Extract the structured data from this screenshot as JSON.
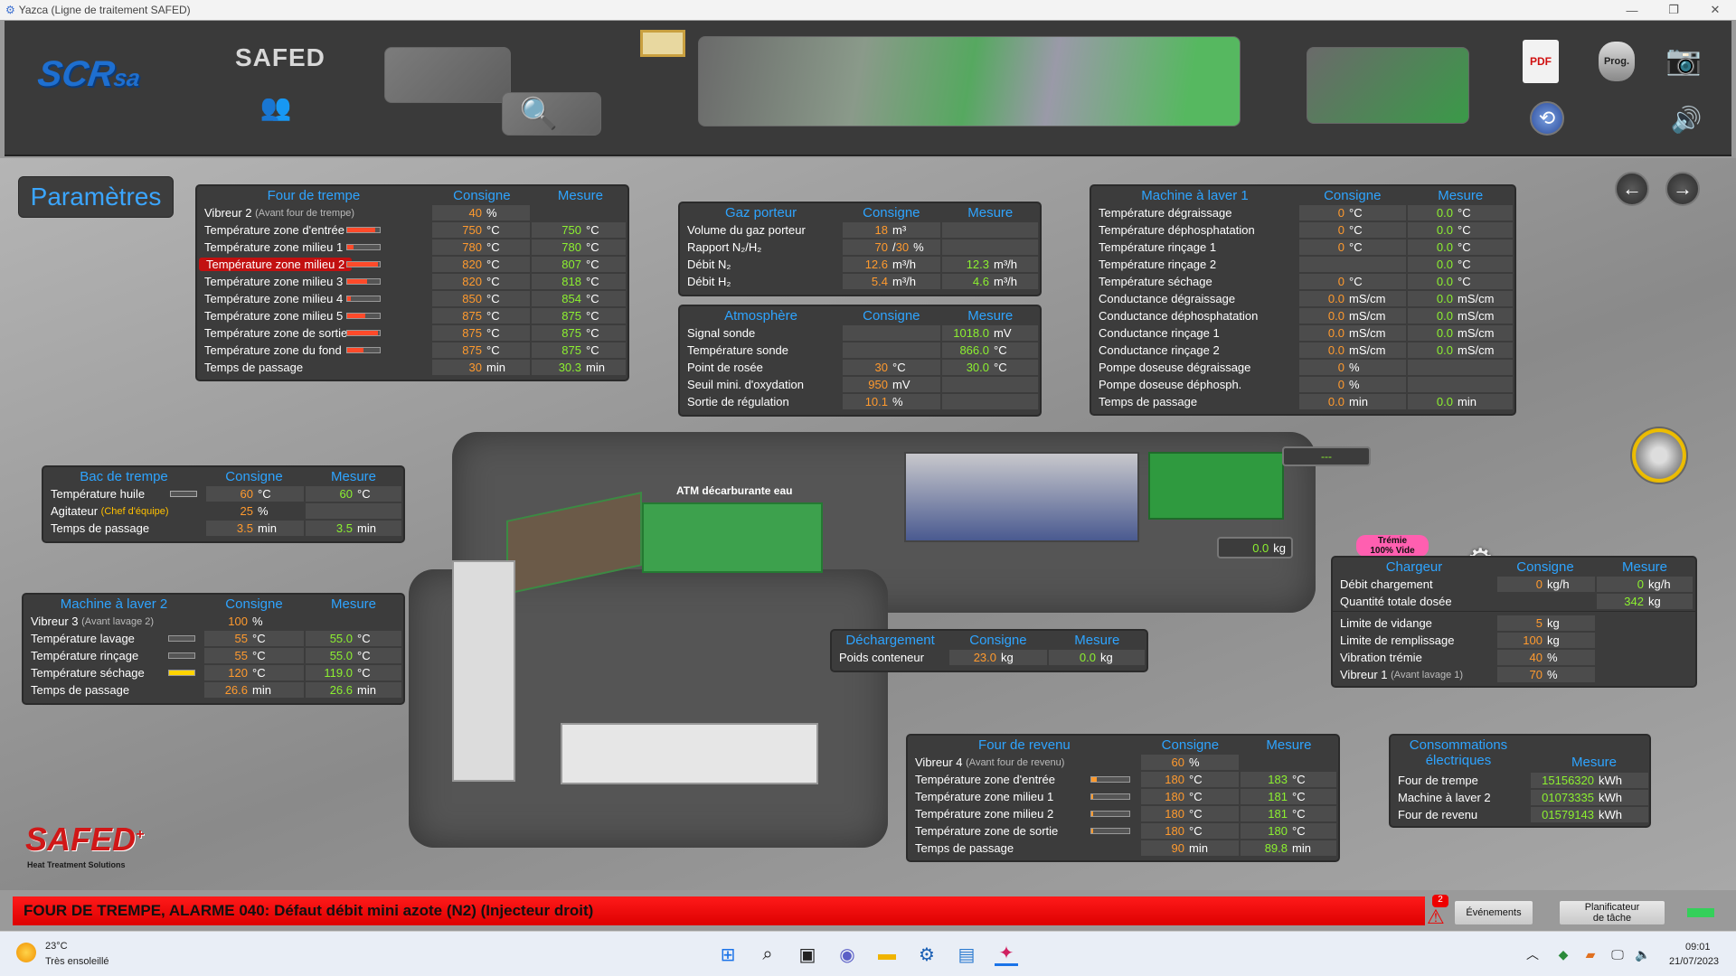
{
  "window": {
    "title": "Yazca (Ligne de traitement SAFED)"
  },
  "header": {
    "brand": "SCR",
    "brand_suffix": "sa",
    "safed": "SAFED",
    "prog": "Prog.",
    "pdf": "PDF"
  },
  "page_title": "Paramètres",
  "four_trempe": {
    "title": "Four de trempe",
    "consigne": "Consigne",
    "mesure": "Mesure",
    "vibreur": {
      "label": "Vibreur 2",
      "sub": "(Avant four de trempe)",
      "c": "40",
      "cu": "%"
    },
    "rows": [
      {
        "label": "Température zone d'entrée",
        "c": "750",
        "cu": "°C",
        "m": "750",
        "mu": "°C",
        "fill": 0.85
      },
      {
        "label": "Température zone milieu 1",
        "c": "780",
        "cu": "°C",
        "m": "780",
        "mu": "°C",
        "fill": 0.2
      },
      {
        "label": "Température zone milieu 2",
        "c": "820",
        "cu": "°C",
        "m": "807",
        "mu": "°C",
        "fill": 0.95
      },
      {
        "label": "Température zone milieu 3",
        "c": "820",
        "cu": "°C",
        "m": "818",
        "mu": "°C",
        "fill": 0.6
      },
      {
        "label": "Température zone milieu 4",
        "c": "850",
        "cu": "°C",
        "m": "854",
        "mu": "°C",
        "fill": 0.1
      },
      {
        "label": "Température zone milieu 5",
        "c": "875",
        "cu": "°C",
        "m": "875",
        "mu": "°C",
        "fill": 0.55
      },
      {
        "label": "Température zone de sortie",
        "c": "875",
        "cu": "°C",
        "m": "875",
        "mu": "°C",
        "fill": 0.95
      },
      {
        "label": "Température zone du fond",
        "c": "875",
        "cu": "°C",
        "m": "875",
        "mu": "°C",
        "fill": 0.5
      }
    ],
    "passage": {
      "label": "Temps de passage",
      "c": "30",
      "cu": "min",
      "m": "30.3",
      "mu": "min"
    }
  },
  "gaz": {
    "title": "Gaz porteur",
    "consigne": "Consigne",
    "mesure": "Mesure",
    "rows": [
      {
        "label": "Volume du gaz porteur",
        "c": "18",
        "cu": "m³",
        "m": "",
        "mu": ""
      },
      {
        "label": "Rapport N₂/H₂",
        "c": "70",
        "c2": "30",
        "cu": "%",
        "m": "",
        "mu": ""
      },
      {
        "label": "Débit N₂",
        "c": "12.6",
        "cu": "m³/h",
        "m": "12.3",
        "mu": "m³/h"
      },
      {
        "label": "Débit H₂",
        "c": "5.4",
        "cu": "m³/h",
        "m": "4.6",
        "mu": "m³/h"
      }
    ]
  },
  "atmo": {
    "title": "Atmosphère",
    "consigne": "Consigne",
    "mesure": "Mesure",
    "rows": [
      {
        "label": "Signal sonde",
        "c": "",
        "cu": "",
        "m": "1018.0",
        "mu": "mV"
      },
      {
        "label": "Température sonde",
        "c": "",
        "cu": "",
        "m": "866.0",
        "mu": "°C"
      },
      {
        "label": "Point de rosée",
        "c": "30",
        "cu": "°C",
        "m": "30.0",
        "mu": "°C"
      },
      {
        "label": "Seuil mini. d'oxydation",
        "c": "950",
        "cu": "mV",
        "m": "",
        "mu": ""
      },
      {
        "label": "Sortie de régulation",
        "c": "10.1",
        "cu": "%",
        "m": "",
        "mu": ""
      }
    ]
  },
  "mal1": {
    "title": "Machine à laver 1",
    "consigne": "Consigne",
    "mesure": "Mesure",
    "rows": [
      {
        "label": "Température dégraissage",
        "c": "0",
        "cu": "°C",
        "m": "0.0",
        "mu": "°C"
      },
      {
        "label": "Température déphosphatation",
        "c": "0",
        "cu": "°C",
        "m": "0.0",
        "mu": "°C"
      },
      {
        "label": "Température rinçage 1",
        "c": "0",
        "cu": "°C",
        "m": "0.0",
        "mu": "°C"
      },
      {
        "label": "Température rinçage 2",
        "c": "",
        "cu": "",
        "m": "0.0",
        "mu": "°C"
      },
      {
        "label": "Température séchage",
        "c": "0",
        "cu": "°C",
        "m": "0.0",
        "mu": "°C"
      },
      {
        "label": "Conductance dégraissage",
        "c": "0.0",
        "cu": "mS/cm",
        "m": "0.0",
        "mu": "mS/cm"
      },
      {
        "label": "Conductance déphosphatation",
        "c": "0.0",
        "cu": "mS/cm",
        "m": "0.0",
        "mu": "mS/cm"
      },
      {
        "label": "Conductance rinçage 1",
        "c": "0.0",
        "cu": "mS/cm",
        "m": "0.0",
        "mu": "mS/cm"
      },
      {
        "label": "Conductance rinçage 2",
        "c": "0.0",
        "cu": "mS/cm",
        "m": "0.0",
        "mu": "mS/cm"
      },
      {
        "label": "Pompe doseuse dégraissage",
        "c": "0",
        "cu": "%",
        "m": "",
        "mu": ""
      },
      {
        "label": "Pompe doseuse déphosph.",
        "c": "0",
        "cu": "%",
        "m": "",
        "mu": ""
      },
      {
        "label": "Temps de passage",
        "c": "0.0",
        "cu": "min",
        "m": "0.0",
        "mu": "min"
      }
    ]
  },
  "bac": {
    "title": "Bac de trempe",
    "consigne": "Consigne",
    "mesure": "Mesure",
    "huile": {
      "label": "Température huile",
      "c": "60",
      "cu": "°C",
      "m": "60",
      "mu": "°C"
    },
    "agit": {
      "label": "Agitateur",
      "sub": "(Chef d'équipe)",
      "c": "25",
      "cu": "%"
    },
    "passage": {
      "label": "Temps de passage",
      "c": "3.5",
      "cu": "min",
      "m": "3.5",
      "mu": "min"
    }
  },
  "mal2": {
    "title": "Machine à laver 2",
    "consigne": "Consigne",
    "mesure": "Mesure",
    "vibreur": {
      "label": "Vibreur 3",
      "sub": "(Avant lavage 2)",
      "c": "100",
      "cu": "%"
    },
    "rows": [
      {
        "label": "Température lavage",
        "c": "55",
        "cu": "°C",
        "m": "55.0",
        "mu": "°C",
        "fill": 0
      },
      {
        "label": "Température rinçage",
        "c": "55",
        "cu": "°C",
        "m": "55.0",
        "mu": "°C",
        "fill": 0
      },
      {
        "label": "Température séchage",
        "c": "120",
        "cu": "°C",
        "m": "119.0",
        "mu": "°C",
        "fill": 1
      }
    ],
    "passage": {
      "label": "Temps de passage",
      "c": "26.6",
      "cu": "min",
      "m": "26.6",
      "mu": "min"
    }
  },
  "floor": {
    "atm_label": "ATM décarburante eau",
    "dash": "---",
    "kg": "0.0",
    "kg_u": "kg"
  },
  "tremie": {
    "line1": "Trémie",
    "line2": "100% Vide"
  },
  "chargeur": {
    "title": "Chargeur",
    "consigne": "Consigne",
    "mesure": "Mesure",
    "r1": {
      "label": "Débit chargement",
      "c": "0",
      "cu": "kg/h",
      "m": "0",
      "mu": "kg/h"
    },
    "r2": {
      "label": "Quantité totale dosée",
      "m": "342",
      "mu": "kg"
    },
    "r3": {
      "label": "Limite de vidange",
      "c": "5",
      "cu": "kg"
    },
    "r4": {
      "label": "Limite de remplissage",
      "c": "100",
      "cu": "kg"
    },
    "r5": {
      "label": "Vibration trémie",
      "c": "40",
      "cu": "%"
    },
    "r6": {
      "label": "Vibreur 1",
      "sub": "(Avant lavage 1)",
      "c": "70",
      "cu": "%"
    }
  },
  "dechargement": {
    "title": "Déchargement",
    "consigne": "Consigne",
    "mesure": "Mesure",
    "label": "Poids conteneur",
    "c": "23.0",
    "cu": "kg",
    "m": "0.0",
    "mu": "kg"
  },
  "four_revenu": {
    "title": "Four de revenu",
    "consigne": "Consigne",
    "mesure": "Mesure",
    "vibreur": {
      "label": "Vibreur 4",
      "sub": "(Avant four de revenu)",
      "c": "60",
      "cu": "%"
    },
    "rows": [
      {
        "label": "Température zone d'entrée",
        "c": "180",
        "cu": "°C",
        "m": "183",
        "mu": "°C",
        "fill": 0.15
      },
      {
        "label": "Température zone milieu 1",
        "c": "180",
        "cu": "°C",
        "m": "181",
        "mu": "°C",
        "fill": 0.05
      },
      {
        "label": "Température zone milieu 2",
        "c": "180",
        "cu": "°C",
        "m": "181",
        "mu": "°C",
        "fill": 0.05
      },
      {
        "label": "Température zone de sortie",
        "c": "180",
        "cu": "°C",
        "m": "180",
        "mu": "°C",
        "fill": 0.05
      }
    ],
    "passage": {
      "label": "Temps de passage",
      "c": "90",
      "cu": "min",
      "m": "89.8",
      "mu": "min"
    }
  },
  "conso": {
    "title1": "Consommations",
    "title2": "électriques",
    "mesure": "Mesure",
    "rows": [
      {
        "label": "Four de trempe",
        "m": "15156320",
        "mu": "kWh"
      },
      {
        "label": "Machine à laver 2",
        "m": "01073335",
        "mu": "kWh"
      },
      {
        "label": "Four de revenu",
        "m": "01579143",
        "mu": "kWh"
      }
    ]
  },
  "alarm": {
    "text": "FOUR DE TREMPE, ALARME 040: Défaut débit mini azote (N2) (Injecteur droit)",
    "count": "2"
  },
  "buttons": {
    "events": "Événements",
    "planner_1": "Planificateur",
    "planner_2": "de tâche"
  },
  "logo_bottom": {
    "name": "SAFED",
    "plus": "+",
    "tagline": "Heat Treatment Solutions"
  },
  "taskbar": {
    "temp": "23°C",
    "weather": "Très ensoleillé",
    "time": "09:01",
    "date": "21/07/2023"
  },
  "colors": {
    "accent": "#2ea4ff",
    "consigne": "#ff9a2e",
    "mesure": "#8cf030",
    "alarm": "#ff1a1a"
  }
}
